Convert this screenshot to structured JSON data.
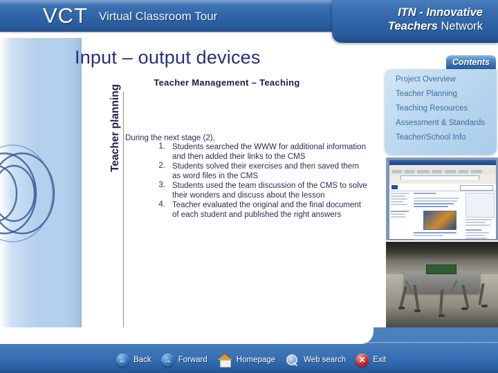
{
  "header": {
    "logo": "VCT",
    "logo_subtitle": "Virtual Classroom Tour",
    "brand_line1": "ITN - Innovative",
    "brand_line2_bold": "Teachers",
    "brand_line2_rest": " Network",
    "accent_color": "#2f63a6"
  },
  "slide": {
    "title": "Input – output devices",
    "subtitle": "Teacher Management – Teaching",
    "side_label": "Teacher planning",
    "lead": "During the next stage (2),",
    "items": [
      {
        "num": "1.",
        "text": "Students searched the WWW for additional information and then added their links to the CMS"
      },
      {
        "num": "2.",
        "text": "Students solved their exercises and then saved them as word files in the CMS"
      },
      {
        "num": "3.",
        "text": "Students used the team discussion of the CMS to solve their wonders and discuss about the lesson"
      },
      {
        "num": "4.",
        "text": "Teacher evaluated the original and the final document of each student  and published the right answers"
      }
    ],
    "title_color": "#262f7a"
  },
  "contents": {
    "tab_label": "Contents",
    "items": [
      "Project Overview",
      "Teacher Planning",
      "Teaching  Resources",
      "Assessment & Standards",
      "Teacher/School Info"
    ],
    "link_color": "#3f6fa0"
  },
  "media": {
    "screenshot_caption": "cms-browser-screenshot",
    "photo_caption": "robot-photo"
  },
  "footer": {
    "nav": [
      {
        "icon": "arrow-left-icon",
        "label": "Back"
      },
      {
        "icon": "arrow-right-icon",
        "label": "Forward"
      },
      {
        "icon": "house-icon",
        "label": "Homepage"
      },
      {
        "icon": "magnifier-icon",
        "label": "Web search"
      },
      {
        "icon": "x-close-icon",
        "label": "Exit"
      }
    ],
    "bar_color": "#2f68ad"
  }
}
